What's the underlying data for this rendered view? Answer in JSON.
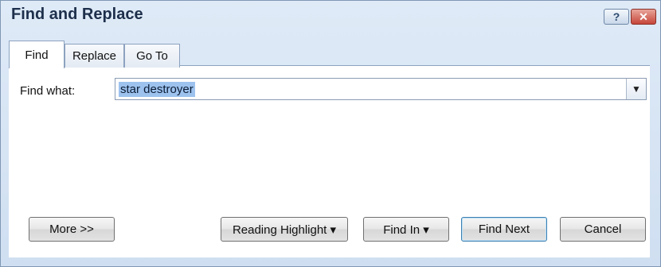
{
  "window": {
    "title": "Find and Replace",
    "help_label": "?",
    "close_label": "✕"
  },
  "tabs": [
    {
      "label": "Find",
      "active": true
    },
    {
      "label": "Replace",
      "active": false
    },
    {
      "label": "Go To",
      "active": false
    }
  ],
  "find": {
    "label": "Find what:",
    "value": "star destroyer"
  },
  "buttons": {
    "more": "More >>",
    "reading_highlight": "Reading Highlight ▾",
    "find_in": "Find In ▾",
    "find_next": "Find Next",
    "cancel": "Cancel"
  }
}
